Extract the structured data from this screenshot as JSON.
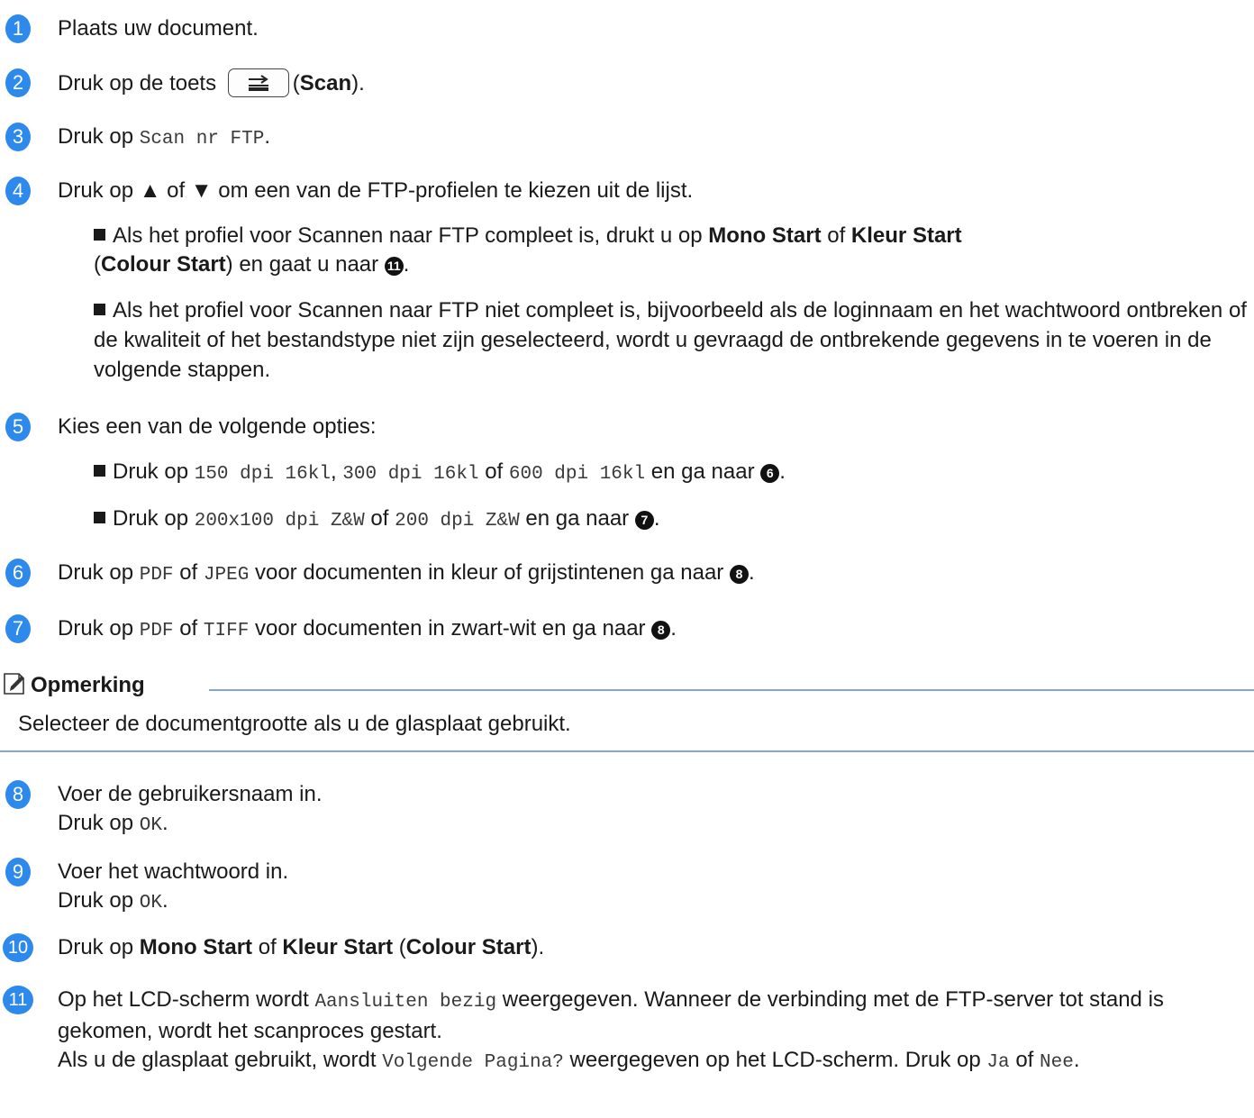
{
  "steps": {
    "s1": {
      "num": "1",
      "text": "Plaats uw document."
    },
    "s2": {
      "num": "2",
      "pre": "Druk op de toets",
      "bold": "Scan",
      "post": ")."
    },
    "s3": {
      "num": "3",
      "pre": "Druk op",
      "code": "Scan nr FTP",
      "post": "."
    },
    "s4": {
      "num": "4",
      "text": "Druk op ▲ of ▼ om een van de FTP-profielen te kiezen uit de lijst.",
      "b1_pre": "Als het profiel voor Scannen naar FTP compleet is, drukt u op",
      "b1_mono_start": "Mono Start",
      "b1_of": "of",
      "b1_kleur": "Kleur Start",
      "b1_colour": "Colour Start",
      "b1_post": ") en gaat u naar",
      "b1_ref": "11",
      "b2": "Als het profiel voor Scannen naar FTP niet compleet is, bijvoorbeeld als de loginnaam en het wachtwoord ontbreken of de kwaliteit of het bestandstype niet zijn geselecteerd, wordt u gevraagd de ontbrekende gegevens in te voeren in de volgende stappen."
    },
    "s5": {
      "num": "5",
      "text": "Kies een van de volgende opties:",
      "b1_pre": "Druk op",
      "b1_c1": "150 dpi 16kl",
      "b1_c2": "300 dpi 16kl",
      "b1_of": "of",
      "b1_c3": "600 dpi 16kl",
      "b1_post": "en ga naar",
      "b1_ref": "6",
      "b2_pre": "Druk op",
      "b2_c1": "200x100 dpi Z&W",
      "b2_of": "of",
      "b2_c2": "200 dpi Z&W",
      "b2_post": "en ga naar",
      "b2_ref": "7"
    },
    "s6": {
      "num": "6",
      "pre": "Druk op",
      "c1": "PDF",
      "of": "of",
      "c2": "JPEG",
      "post": "voor documenten in kleur of grijstintenen ga naar",
      "ref": "8"
    },
    "s7": {
      "num": "7",
      "pre": "Druk op",
      "c1": "PDF",
      "of": "of",
      "c2": "TIFF",
      "post": "voor documenten in zwart-wit en ga naar",
      "ref": "8"
    },
    "s8": {
      "num": "8",
      "line1": "Voer de gebruikersnaam in.",
      "pre": "Druk op",
      "code": "OK"
    },
    "s9": {
      "num": "9",
      "line1": "Voer het wachtwoord in.",
      "pre": "Druk op",
      "code": "OK"
    },
    "s10": {
      "num": "10",
      "pre": "Druk op",
      "mono_start": "Mono Start",
      "of": "of",
      "kleur": "Kleur Start",
      "colour": "Colour Start",
      "post": ")."
    },
    "s11": {
      "num": "11",
      "pre": "Op het LCD-scherm wordt",
      "c1": "Aansluiten bezig",
      "mid": "weergegeven. Wanneer de verbinding met de FTP-server tot stand is gekomen, wordt het scanproces gestart.",
      "pre2": "Als u de glasplaat gebruikt, wordt",
      "c2": "Volgende Pagina?",
      "mid2": "weergegeven op het LCD-scherm. Druk op",
      "c3": "Ja",
      "of": "of",
      "c4": "Nee"
    }
  },
  "note": {
    "title": "Opmerking",
    "text": "Selecteer de documentgrootte als u de glasplaat gebruikt."
  },
  "icons": {
    "scan_key": "scan-key-icon",
    "note": "note-pencil-icon"
  },
  "colors": {
    "accent": "#2e89ec",
    "rule": "#7fa6d8"
  }
}
